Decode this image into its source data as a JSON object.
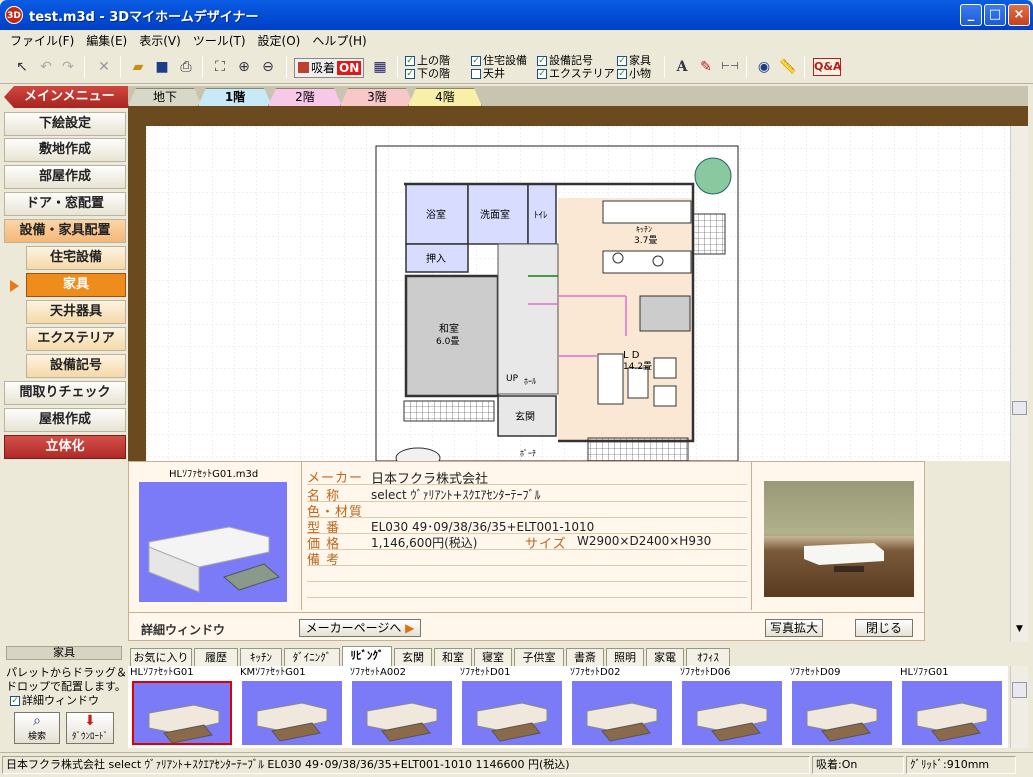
{
  "window": {
    "title": "test.m3d - 3Dマイホームデザイナー",
    "icon_text": "3D",
    "minimize": "_",
    "maximize": "□",
    "close": "×"
  },
  "menu": [
    "ファイル(F)",
    "編集(E)",
    "表示(V)",
    "ツール(T)",
    "設定(O)",
    "ヘルプ(H)"
  ],
  "toolbar": {
    "suction_label": "吸着",
    "suction_state": "ON",
    "qa_label": "Q&A",
    "checks": [
      {
        "label": "上の階",
        "checked": true
      },
      {
        "label": "下の階",
        "checked": true
      },
      {
        "label": "住宅設備",
        "checked": true
      },
      {
        "label": "天井",
        "checked": false
      },
      {
        "label": "設備記号",
        "checked": true
      },
      {
        "label": "エクステリア",
        "checked": true
      },
      {
        "label": "家具",
        "checked": true
      },
      {
        "label": "小物",
        "checked": true
      }
    ]
  },
  "floor_tabs": [
    {
      "label": "地下",
      "color": "#d8d8c8"
    },
    {
      "label": "1階",
      "color": "#c8eaf8",
      "active": true
    },
    {
      "label": "2階",
      "color": "#f8c8e8"
    },
    {
      "label": "3階",
      "color": "#f8c8c8"
    },
    {
      "label": "4階",
      "color": "#f8f0a8"
    }
  ],
  "sidebar": {
    "main_menu": "メインメニュー",
    "items": [
      {
        "label": "下絵設定",
        "style": "normal"
      },
      {
        "label": "敷地作成",
        "style": "normal"
      },
      {
        "label": "部屋作成",
        "style": "normal"
      },
      {
        "label": "ドア・窓配置",
        "style": "normal"
      },
      {
        "label": "設備・家具配置",
        "style": "orange"
      },
      {
        "label": "住宅設備",
        "style": "sub"
      },
      {
        "label": "家具",
        "style": "sel"
      },
      {
        "label": "天井器具",
        "style": "sub"
      },
      {
        "label": "エクステリア",
        "style": "sub"
      },
      {
        "label": "設備記号",
        "style": "sub"
      },
      {
        "label": "間取りチェック",
        "style": "normal"
      },
      {
        "label": "屋根作成",
        "style": "normal"
      },
      {
        "label": "立体化",
        "style": "red"
      }
    ]
  },
  "plan": {
    "rooms": [
      "浴室",
      "洗面室",
      "ﾄｲﾚ",
      "ｷｯﾁﾝ",
      "3.7畳",
      "押入",
      "和室",
      "6.0畳",
      "L D",
      "14.2畳",
      "UP",
      "ﾎｰﾙ",
      "玄関",
      "ﾎﾟｰﾁ"
    ]
  },
  "detail": {
    "file": "HLｿﾌｧｾｯﾄG01.m3d",
    "window_label": "詳細ウィンドウ",
    "maker_label": "メーカー",
    "maker": "日本フクラ株式会社",
    "name_label": "名 称",
    "name": "select ｳﾞｧﾘｱﾝﾄ+ｽｸｴｱｾﾝﾀｰﾃｰﾌﾞﾙ",
    "color_label": "色・材質",
    "color": "",
    "model_label": "型 番",
    "model": "EL030 49･09/38/36/35+ELT001-1010",
    "price_label": "価 格",
    "price": "1,146,600円(税込)",
    "size_label": "サイズ",
    "size": "W2900×D2400×H930",
    "note_label": "備 考",
    "note": "",
    "maker_btn": "メーカーページへ",
    "photo_btn": "写真拡大",
    "close_btn": "閉じる"
  },
  "category_tabs": [
    "お気に入り",
    "履歴",
    "ｷｯﾁﾝ",
    "ﾀﾞｲﾆﾝｸﾞ",
    "ﾘﾋﾞﾝｸﾞ",
    "玄関",
    "和室",
    "寝室",
    "子供室",
    "書斎",
    "照明",
    "家電",
    "ｵﾌｨｽ"
  ],
  "active_category": "ﾘﾋﾞﾝｸﾞ",
  "palette": [
    {
      "label": "HLｿﾌｧｾｯﾄG01",
      "selected": true
    },
    {
      "label": "KMｿﾌｧｾｯﾄG01"
    },
    {
      "label": "ｿﾌｧｾｯﾄA002"
    },
    {
      "label": "ｿﾌｧｾｯﾄD01"
    },
    {
      "label": "ｿﾌｧｾｯﾄD02"
    },
    {
      "label": "ｿﾌｧｾｯﾄD06"
    },
    {
      "label": "ｿﾌｧｾｯﾄD09"
    },
    {
      "label": "HLｿﾌｧG01"
    }
  ],
  "left_panel": {
    "title": "家具",
    "desc1": "パレットからドラッグ＆",
    "desc2": "ドロップで配置します。",
    "detail_check": "詳細ウィンドウ",
    "search": "検索",
    "download": "ﾀﾞｳﾝﾛｰﾄﾞ"
  },
  "status": {
    "main": "日本フクラ株式会社 select ｳﾞｧﾘｱﾝﾄ+ｽｸｴｱｾﾝﾀｰﾃｰﾌﾞﾙ EL030 49･09/38/36/35+ELT001-1010 1146600 円(税込)",
    "suction": "吸着:On",
    "grid": "ｸﾞﾘｯﾄﾞ:910mm"
  }
}
